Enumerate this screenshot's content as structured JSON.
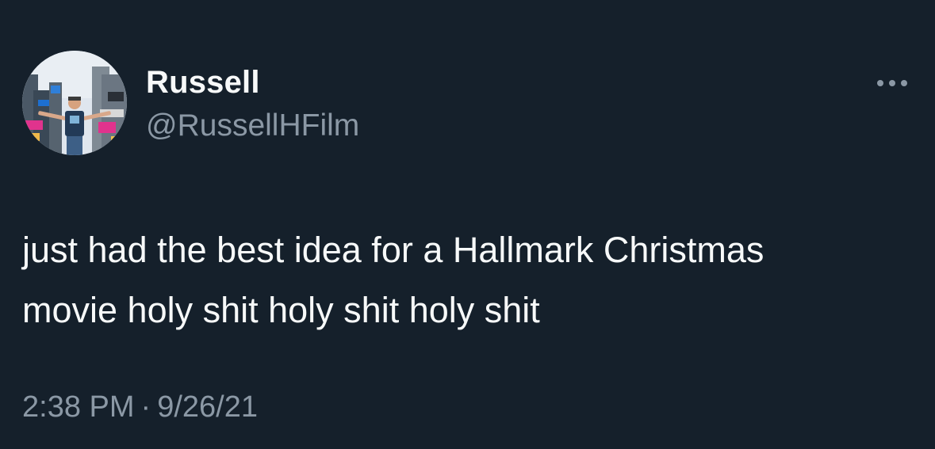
{
  "author": {
    "display_name": "Russell",
    "handle": "@RussellHFilm",
    "avatar_icon": "profile-photo"
  },
  "more_icon": "more-options-icon",
  "tweet": {
    "lines": [
      "just had the best idea for a Hallmark Christmas",
      "movie holy shit holy shit holy shit"
    ]
  },
  "meta": {
    "time": "2:38 PM",
    "separator": "·",
    "date": "9/26/21"
  },
  "colors": {
    "background": "#15202b",
    "primary_text": "#f7f9f9",
    "secondary_text": "#8b98a5"
  }
}
